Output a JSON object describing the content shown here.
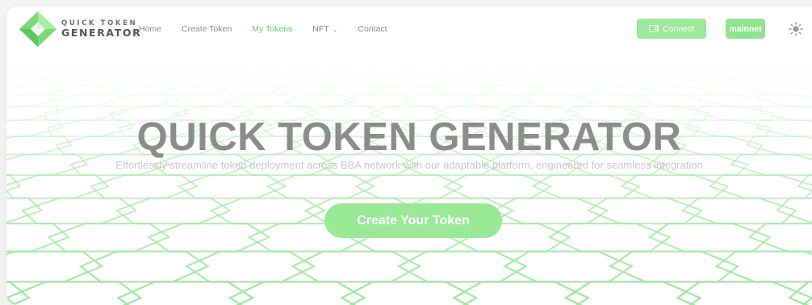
{
  "brand": {
    "line1": "QUICK TOKEN",
    "line2": "GENERATOR",
    "accent_color": "#8fe58e"
  },
  "nav": {
    "items": [
      {
        "label": "Home",
        "active": false
      },
      {
        "label": "Create Token",
        "active": false
      },
      {
        "label": "My Tokens",
        "active": true
      },
      {
        "label": "NFT",
        "active": false,
        "has_dropdown": true
      },
      {
        "label": "Contact",
        "active": false
      }
    ]
  },
  "header_actions": {
    "connect_label": "Connect",
    "connect_icon": "wallet-icon",
    "network_label": "mainnet",
    "theme_icon": "sun-icon"
  },
  "hero": {
    "title": "QUICK TOKEN GENERATOR",
    "subtitle": "Effortlessly streamline token deployment across BBA network with our adaptable platform, engineered for seamless integration",
    "cta_label": "Create Your Token",
    "mesh_color": "#9be89a"
  }
}
